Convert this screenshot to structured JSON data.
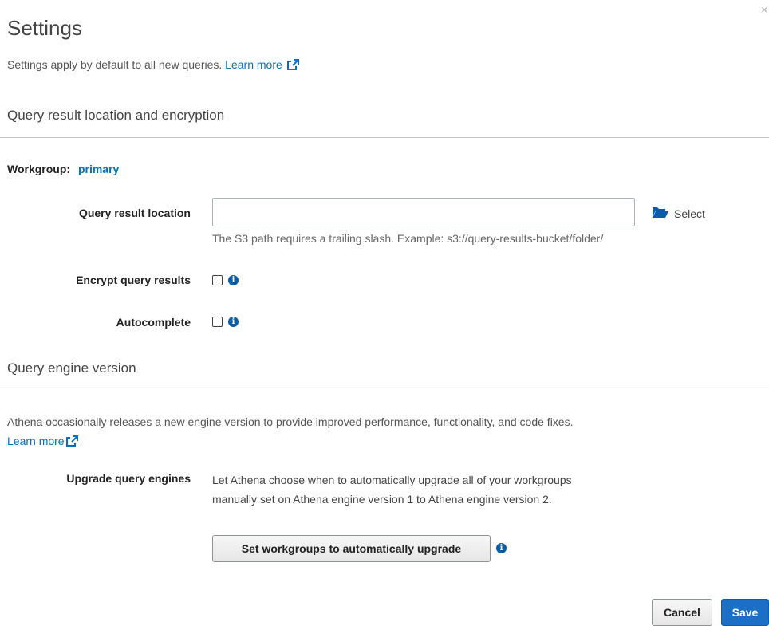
{
  "modal": {
    "title": "Settings",
    "close_label": "×",
    "intro_text": "Settings apply by default to all new queries. ",
    "learn_more_label": "Learn more"
  },
  "query_result_section": {
    "title": "Query result location and encryption",
    "workgroup_label": "Workgroup:",
    "workgroup_value": "primary",
    "location_label": "Query result location",
    "location_value": "",
    "select_label": "Select",
    "location_hint": "The S3 path requires a trailing slash. Example: s3://query-results-bucket/folder/",
    "encrypt_label": "Encrypt query results",
    "encrypt_checked": false,
    "autocomplete_label": "Autocomplete",
    "autocomplete_checked": false
  },
  "engine_section": {
    "title": "Query engine version",
    "description": "Athena occasionally releases a new engine version to provide improved performance, functionality, and code fixes.",
    "learn_more_label": "Learn more",
    "upgrade_label": "Upgrade query engines",
    "upgrade_text": "Let Athena choose when to automatically upgrade all of your workgroups manually set on Athena engine version 1 to Athena engine version 2.",
    "upgrade_button_label": "Set workgroups to automatically upgrade"
  },
  "footer": {
    "cancel_label": "Cancel",
    "save_label": "Save"
  },
  "icons": {
    "info": "info-icon",
    "external_link": "external-link-icon",
    "folder": "folder-open-icon",
    "close": "close-icon"
  },
  "colors": {
    "link": "#0073bb",
    "primary_button": "#1b6fc7",
    "info_icon": "#0a5ca8"
  }
}
